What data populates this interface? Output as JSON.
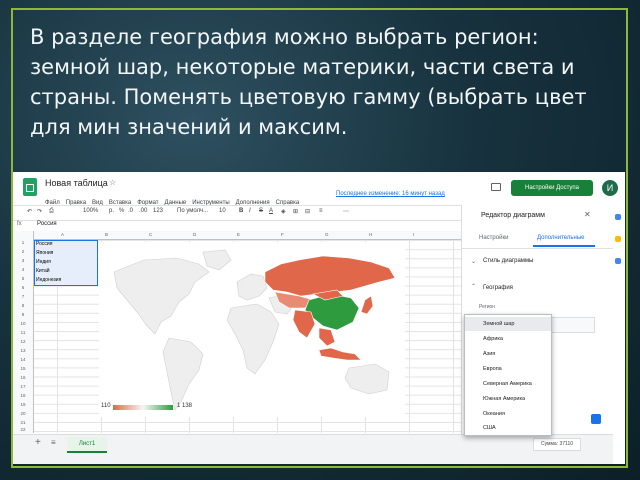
{
  "slide": {
    "caption": "В разделе география можно выбрать регион: земной шар, некоторые материки, части света и страны. Поменять цветовую гамму  (выбрать цвет для мин значений и максим."
  },
  "sheets": {
    "doc_title": "Новая таблица",
    "menu": [
      "Файл",
      "Правка",
      "Вид",
      "Вставка",
      "Формат",
      "Данные",
      "Инструменты",
      "Дополнения",
      "Справка"
    ],
    "last_edit": "Последнее изменение: 16 минут назад",
    "share_label": "Настройки Доступа",
    "avatar_letter": "И",
    "toolbar": {
      "zoom": "100%",
      "currency": "р.",
      "percent": "%",
      "dec_dec": ".0",
      "dec_inc": ".00",
      "format": "123",
      "font": "По умолч...",
      "size": "10"
    },
    "name_box": "Россия",
    "columns": [
      "A",
      "B",
      "C",
      "D",
      "E",
      "F",
      "G",
      "H",
      "I"
    ],
    "rows": [
      "1",
      "2",
      "3",
      "4",
      "5",
      "6",
      "7",
      "8",
      "9",
      "10",
      "11",
      "12",
      "13",
      "14",
      "15",
      "16",
      "17",
      "18",
      "19",
      "20",
      "21",
      "22"
    ],
    "cells": [
      "Россия",
      "Япония",
      "Индия",
      "Китай",
      "Индонезия"
    ],
    "sheet_tab": "Лист1",
    "sum_label": "Сумма: 37110"
  },
  "chart": {
    "legend_min": "110",
    "legend_max": "1 138",
    "colors": {
      "low": "#e1674a",
      "mid": "#f6f6f6",
      "high": "#2e9b3e"
    }
  },
  "editor": {
    "title": "Редактор диаграмм",
    "tab_setup": "Настройки",
    "tab_custom": "Дополнительные",
    "section_style": "Стиль диаграммы",
    "section_geo": "География",
    "region_label": "Регион",
    "options": [
      "Земной шар",
      "Африка",
      "Азия",
      "Европа",
      "Северная Америка",
      "Южная Америка",
      "Океания",
      "США"
    ],
    "selected": "Земной шар"
  },
  "colors": {
    "accent": "#188038",
    "link": "#1a73e8",
    "frame": "#8fb83a"
  }
}
